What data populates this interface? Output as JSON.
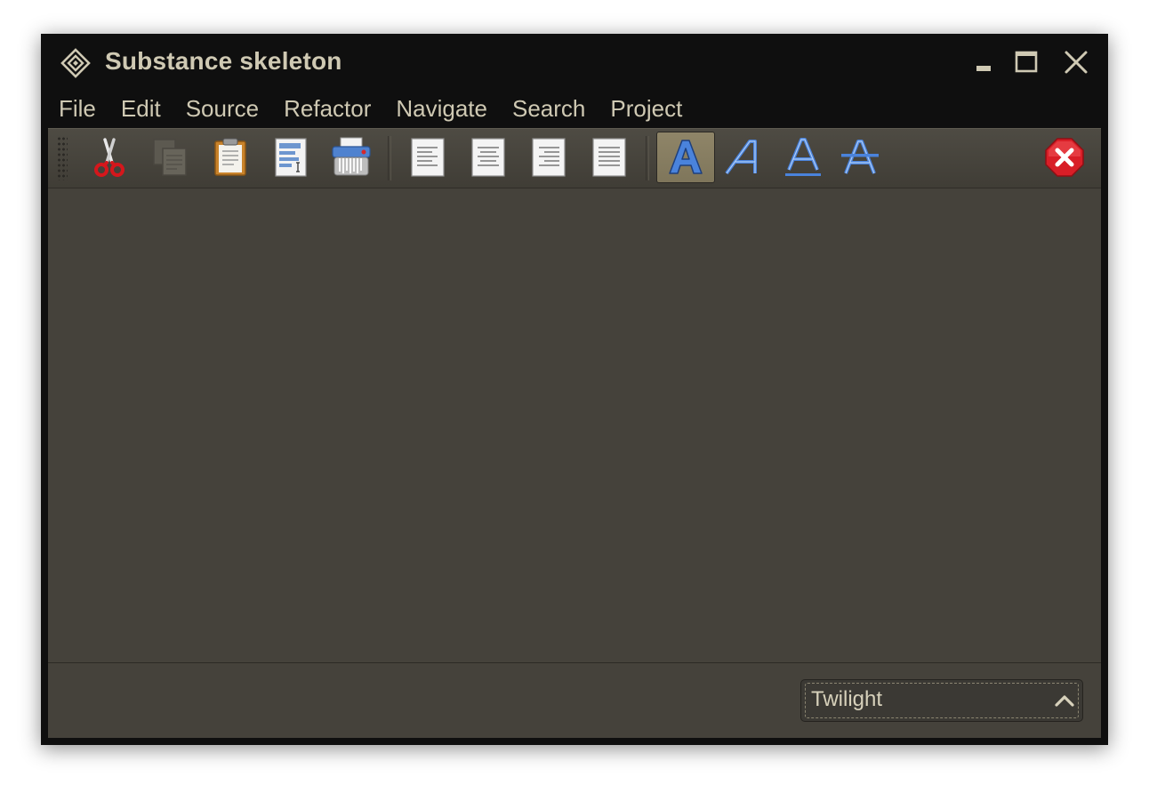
{
  "window": {
    "title": "Substance skeleton",
    "controls": [
      "minimize-icon",
      "maximize-icon",
      "close-icon"
    ]
  },
  "menubar": {
    "items": [
      "File",
      "Edit",
      "Source",
      "Refactor",
      "Navigate",
      "Search",
      "Project"
    ]
  },
  "toolbar": {
    "buttons": [
      {
        "icon": "scissors-icon",
        "enabled": true
      },
      {
        "icon": "copy-icon",
        "enabled": false
      },
      {
        "icon": "clipboard-icon",
        "enabled": true
      },
      {
        "icon": "document-edit-icon",
        "enabled": true
      },
      {
        "icon": "shredder-icon",
        "enabled": true
      },
      {
        "icon": "align-left-icon",
        "enabled": true
      },
      {
        "icon": "align-center-icon",
        "enabled": true
      },
      {
        "icon": "align-right-icon",
        "enabled": true
      },
      {
        "icon": "align-justify-icon",
        "enabled": true
      },
      {
        "icon": "bold-text-icon",
        "selected": true
      },
      {
        "icon": "italic-text-icon",
        "selected": false
      },
      {
        "icon": "underline-text-icon",
        "selected": false
      },
      {
        "icon": "strikethrough-text-icon",
        "selected": false
      },
      {
        "icon": "stop-error-icon",
        "enabled": true
      }
    ]
  },
  "statusbar": {
    "skin_selector": {
      "value": "Twilight",
      "icon": "chevron-up-icon"
    }
  },
  "colors": {
    "frame": "#0f0f0f",
    "client_bg": "#45423b",
    "foreground": "#cfc9b3",
    "selected_button": "#8a8064",
    "glyph_blue": "#5a8ee0",
    "stop_red": "#d81e27"
  }
}
